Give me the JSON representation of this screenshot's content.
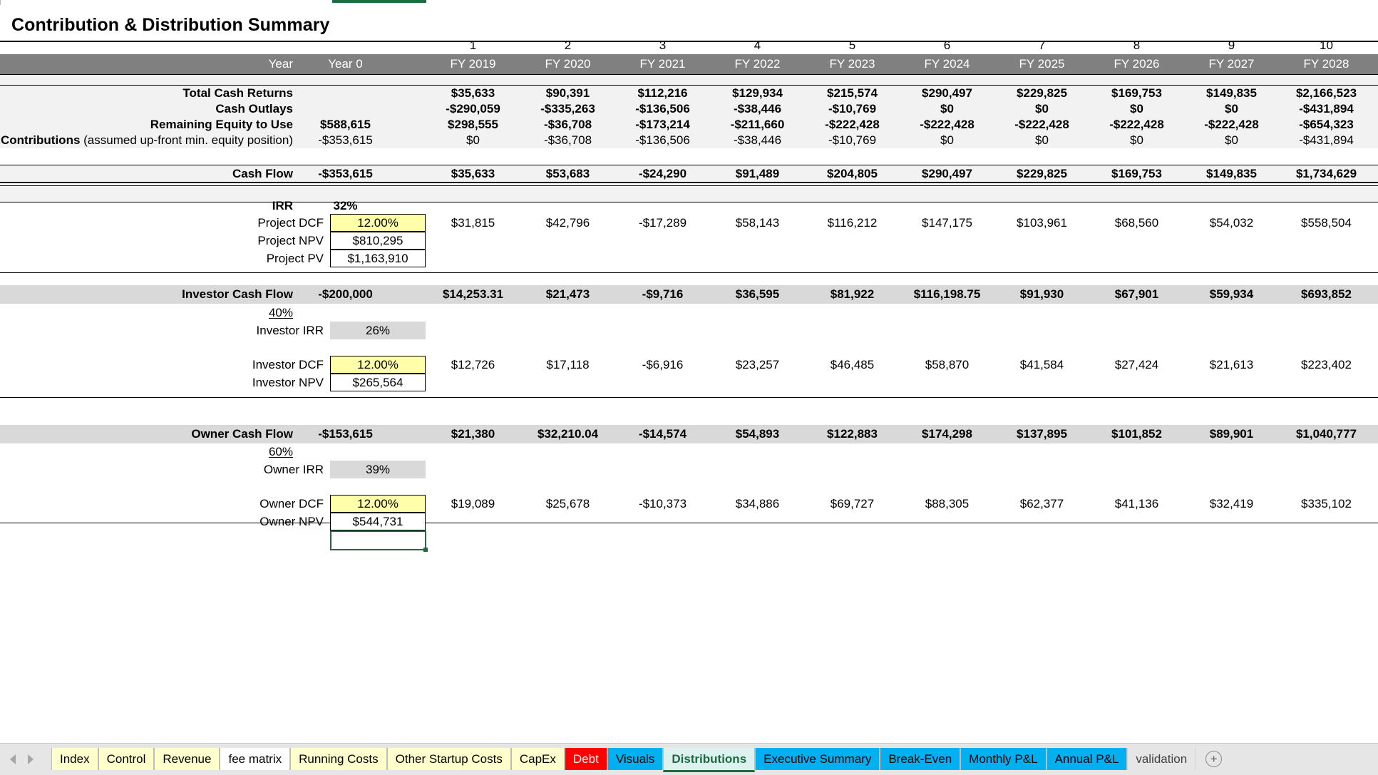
{
  "document": {
    "title": "Contribution & Distribution Summary"
  },
  "columns": {
    "numbers": [
      "1",
      "2",
      "3",
      "4",
      "5",
      "6",
      "7",
      "8",
      "9",
      "10"
    ],
    "header_row_label": "Year",
    "year0_label": "Year 0",
    "fiscal_years": [
      "FY 2019",
      "FY 2020",
      "FY 2021",
      "FY 2022",
      "FY 2023",
      "FY 2024",
      "FY 2025",
      "FY 2026",
      "FY 2027",
      "FY 2028"
    ]
  },
  "sections": {
    "cashflow": {
      "rows": [
        {
          "label": "Total Cash Returns",
          "year0": "",
          "values": [
            "$35,633",
            "$90,391",
            "$112,216",
            "$129,934",
            "$215,574",
            "$290,497",
            "$229,825",
            "$169,753",
            "$149,835",
            "$2,166,523"
          ]
        },
        {
          "label": "Cash Outlays",
          "year0": "",
          "values": [
            "-$290,059",
            "-$335,263",
            "-$136,506",
            "-$38,446",
            "-$10,769",
            "$0",
            "$0",
            "$0",
            "$0",
            "-$431,894"
          ]
        },
        {
          "label": "Remaining Equity to Use",
          "year0": "$588,615",
          "values": [
            "$298,555",
            "-$36,708",
            "-$173,214",
            "-$211,660",
            "-$222,428",
            "-$222,428",
            "-$222,428",
            "-$222,428",
            "-$222,428",
            "-$654,323"
          ]
        },
        {
          "label": "Contributions",
          "label_note": " (assumed up-front min. equity position)",
          "year0": "-$353,615",
          "values": [
            "$0",
            "-$36,708",
            "-$136,506",
            "-$38,446",
            "-$10,769",
            "$0",
            "$0",
            "$0",
            "$0",
            "-$431,894"
          ]
        },
        {
          "label": "Cash Flow",
          "year0": "-$353,615",
          "values": [
            "$35,633",
            "$53,683",
            "-$24,290",
            "$91,489",
            "$204,805",
            "$290,497",
            "$229,825",
            "$169,753",
            "$149,835",
            "$1,734,629"
          ]
        }
      ]
    },
    "project": {
      "irr_label": "IRR",
      "irr_value": "32%",
      "dcf_label": "Project DCF",
      "dcf_value": "12.00%",
      "npv_label": "Project NPV",
      "npv_value": "$810,295",
      "pv_label": "Project PV",
      "pv_value": "$1,163,910",
      "dcf_values": [
        "$31,815",
        "$42,796",
        "-$17,289",
        "$58,143",
        "$116,212",
        "$147,175",
        "$103,961",
        "$68,560",
        "$54,032",
        "$558,504"
      ]
    },
    "investor": {
      "cashflow_label": "Investor Cash Flow",
      "cashflow_year0": "-$200,000",
      "cashflow_values": [
        "$14,253.31",
        "$21,473",
        "-$9,716",
        "$36,595",
        "$81,922",
        "$116,198.75",
        "$91,930",
        "$67,901",
        "$59,934",
        "$693,852"
      ],
      "share_pct": "40%",
      "irr_label": "Investor IRR",
      "irr_value": "26%",
      "dcf_label": "Investor DCF",
      "dcf_value": "12.00%",
      "npv_label": "Investor NPV",
      "npv_value": "$265,564",
      "dcf_values": [
        "$12,726",
        "$17,118",
        "-$6,916",
        "$23,257",
        "$46,485",
        "$58,870",
        "$41,584",
        "$27,424",
        "$21,613",
        "$223,402"
      ]
    },
    "owner": {
      "cashflow_label": "Owner Cash Flow",
      "cashflow_year0": "-$153,615",
      "cashflow_values": [
        "$21,380",
        "$32,210.04",
        "-$14,574",
        "$54,893",
        "$122,883",
        "$174,298",
        "$137,895",
        "$101,852",
        "$89,901",
        "$1,040,777"
      ],
      "share_pct": "60%",
      "irr_label": "Owner IRR",
      "irr_value": "39%",
      "dcf_label": "Owner DCF",
      "dcf_value": "12.00%",
      "npv_label": "Owner NPV",
      "npv_value": "$544,731",
      "dcf_values": [
        "$19,089",
        "$25,678",
        "-$10,373",
        "$34,886",
        "$69,727",
        "$88,305",
        "$62,377",
        "$41,136",
        "$32,419",
        "$335,102"
      ]
    }
  },
  "tabs": [
    {
      "label": "Index",
      "style": "yellow"
    },
    {
      "label": "Control",
      "style": "yellow"
    },
    {
      "label": "Revenue",
      "style": "yellow"
    },
    {
      "label": "fee matrix",
      "style": "white"
    },
    {
      "label": "Running Costs",
      "style": "yellow"
    },
    {
      "label": "Other Startup Costs",
      "style": "yellow"
    },
    {
      "label": "CapEx",
      "style": "yellow"
    },
    {
      "label": "Debt",
      "style": "red"
    },
    {
      "label": "Visuals",
      "style": "cyan"
    },
    {
      "label": "Distributions",
      "style": "active"
    },
    {
      "label": "Executive Summary",
      "style": "cyan"
    },
    {
      "label": "Break-Even",
      "style": "cyan"
    },
    {
      "label": "Monthly P&L",
      "style": "cyan"
    },
    {
      "label": "Annual P&L",
      "style": "cyan"
    },
    {
      "label": "validation",
      "style": "plain"
    }
  ],
  "colors": {
    "header_band": "#808080",
    "input_cell": "#ffffaa",
    "output_cell": "#d9d9d9",
    "selection": "#1e6b42",
    "tab_debt": "#ff0000",
    "tab_cyan": "#00b0f0"
  },
  "controls": {
    "add_sheet": "+",
    "scroll_left": "◀",
    "scroll_right": "▶"
  }
}
